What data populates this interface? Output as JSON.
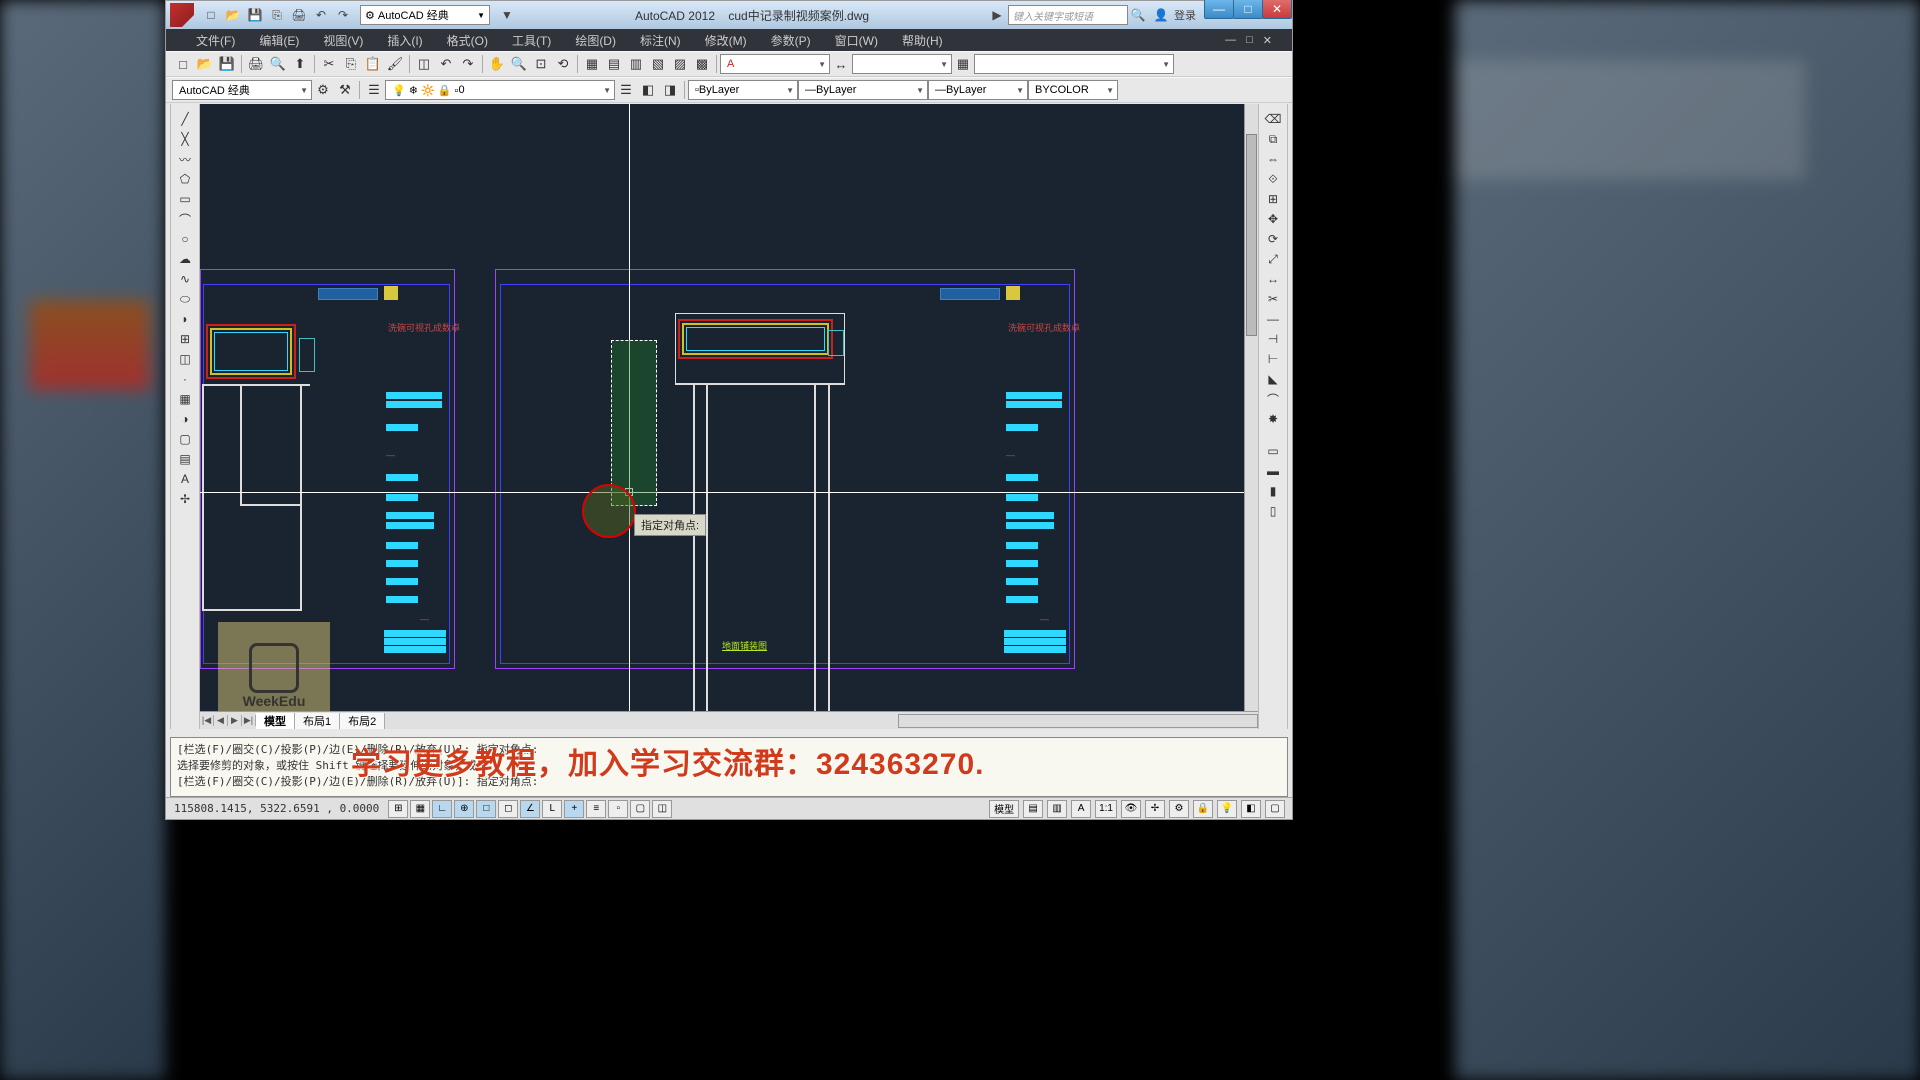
{
  "title": {
    "app": "AutoCAD 2012",
    "file": "cud中记录制视频案例.dwg",
    "search_placeholder": "键入关键字或短语",
    "login": "登录"
  },
  "workspace": {
    "label": "AutoCAD 经典"
  },
  "window_controls": {
    "min": "—",
    "max": "□",
    "close": "✕"
  },
  "menus": [
    "文件(F)",
    "编辑(E)",
    "视图(V)",
    "插入(I)",
    "格式(O)",
    "工具(T)",
    "绘图(D)",
    "标注(N)",
    "修改(M)",
    "参数(P)",
    "窗口(W)",
    "帮助(H)"
  ],
  "layer_dd": {
    "value": "0"
  },
  "line_type": {
    "value": "ByLayer"
  },
  "line_weight": {
    "value": "ByLayer"
  },
  "plot_style": {
    "value": "ByLayer"
  },
  "color_style": {
    "value": "BYCOLOR"
  },
  "layout_tabs": {
    "nav_first": "|◀",
    "nav_prev": "◀",
    "nav_next": "▶",
    "nav_last": "▶|",
    "model": "模型",
    "layout1": "布局1",
    "layout2": "布局2"
  },
  "cmd_history": [
    "[栏选(F)/圈交(C)/投影(P)/边(E)/删除(R)/放弃(U)]:  指定对角点:",
    "选择要修剪的对象，或按住 Shift 键选择要延伸的对象，或",
    "[栏选(F)/圈交(C)/投影(P)/边(E)/删除(R)/放弃(U)]:  指定对角点:"
  ],
  "tooltip": {
    "text": "指定对角点:"
  },
  "status": {
    "coords": "115808.1415, 5322.6591 , 0.0000",
    "model": "模型",
    "scale": "1:1"
  },
  "drawing": {
    "floor_label": "地面铺装图",
    "legend_text": "洗碗可视孔成数卓",
    "week_logo": "WeekEdu"
  },
  "overlay": {
    "promo": "学习更多教程，加入学习交流群：324363270."
  },
  "chart_data": {
    "type": "table",
    "note": "architectural floor-plan — no numeric chart data"
  }
}
